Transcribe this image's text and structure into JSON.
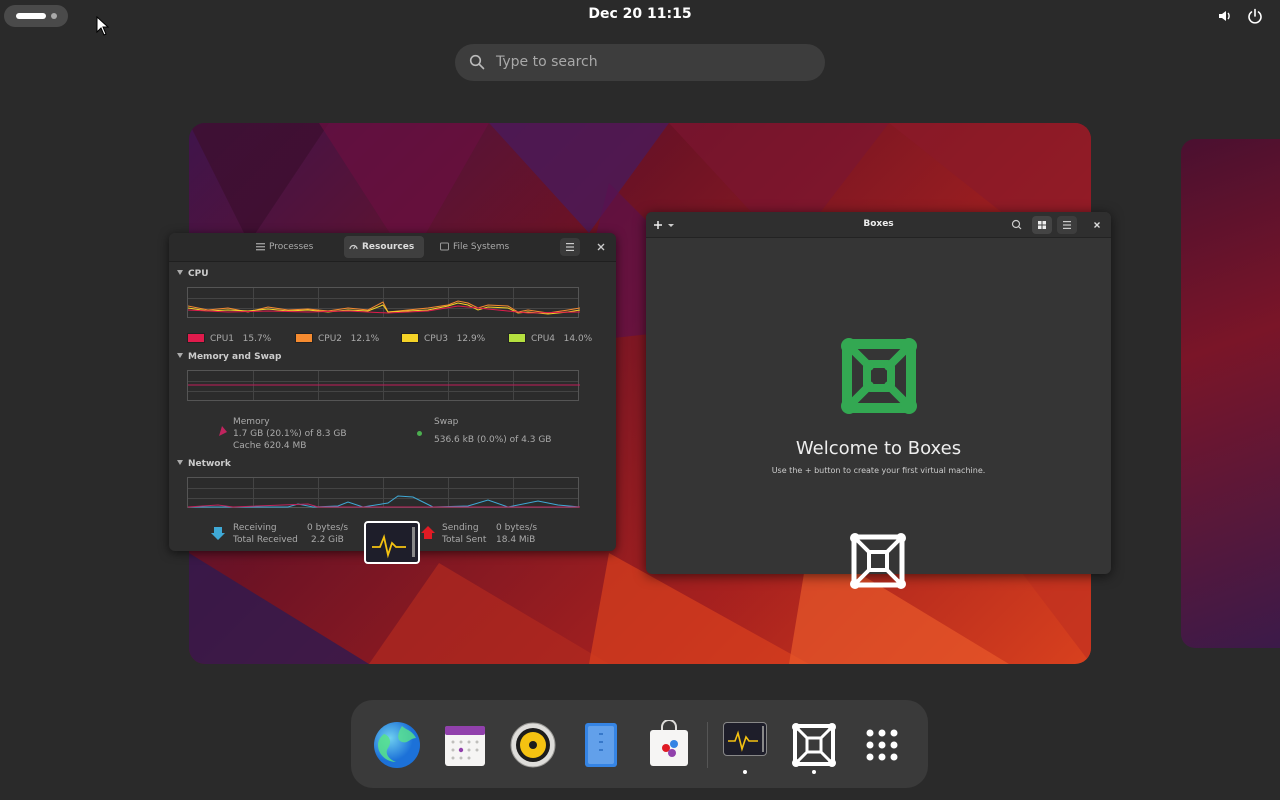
{
  "topbar": {
    "clock": "Dec 20  11:15",
    "icons": [
      "activities-pill",
      "volume-icon",
      "power-icon"
    ]
  },
  "search": {
    "placeholder": "Type to search"
  },
  "system_monitor": {
    "tabs": [
      "Processes",
      "Resources",
      "File Systems"
    ],
    "active_tab": "Resources",
    "sections": {
      "cpu": "CPU",
      "memory": "Memory and Swap",
      "network": "Network"
    },
    "cpu_legend": [
      {
        "label": "CPU1",
        "value": "15.7%",
        "color": "#e01b4c"
      },
      {
        "label": "CPU2",
        "value": "12.1%",
        "color": "#f68b30"
      },
      {
        "label": "CPU3",
        "value": "12.9%",
        "color": "#f5d327"
      },
      {
        "label": "CPU4",
        "value": "14.0%",
        "color": "#b5e03f"
      }
    ],
    "memory": {
      "label": "Memory",
      "usage": "1.7 GB (20.1%) of 8.3 GB",
      "cache": "Cache 620.4 MB"
    },
    "swap": {
      "label": "Swap",
      "usage": "536.6 kB (0.0%) of 4.3 GB"
    },
    "network": {
      "receiving_label": "Receiving",
      "receiving_value": "0 bytes/s",
      "total_received_label": "Total Received",
      "total_received_value": "2.2 GiB",
      "sending_label": "Sending",
      "sending_value": "0 bytes/s",
      "total_sent_label": "Total Sent",
      "total_sent_value": "18.4 MiB"
    }
  },
  "boxes": {
    "title": "Boxes",
    "welcome": "Welcome to Boxes",
    "subtitle": "Use the + button to create your first virtual machine."
  },
  "dash": {
    "apps": [
      "web-browser",
      "calendar",
      "rhythmbox",
      "text-editor",
      "software-center",
      "system-monitor",
      "boxes",
      "show-apps"
    ],
    "running": [
      "system-monitor",
      "boxes"
    ]
  },
  "colors": {
    "accent_green": "#33a852",
    "panel_bg": "#2a2a2a"
  }
}
